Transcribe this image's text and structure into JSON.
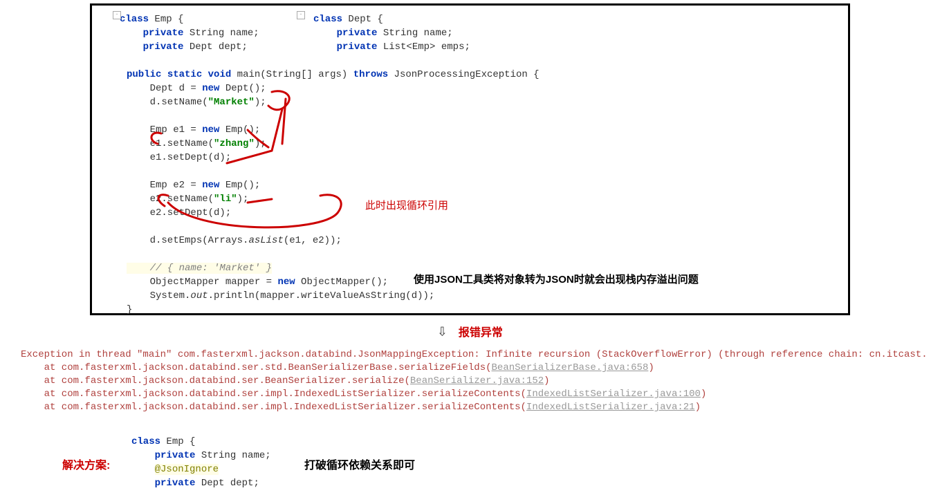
{
  "code": {
    "emp_class": {
      "kw_class": "class",
      "name": "Emp {",
      "kw_private1": "private",
      "type1": "String",
      "field1": "name;",
      "kw_private2": "private",
      "type2": "Dept",
      "field2": "dept;"
    },
    "dept_class": {
      "kw_class": "class",
      "name": "Dept {",
      "kw_private1": "private",
      "type1": "String",
      "field1": "name;",
      "kw_private2": "private",
      "type2": "List<Emp>",
      "field2": "emps;"
    },
    "main": {
      "sig_public": "public",
      "sig_static": "static",
      "sig_void": "void",
      "sig_name": "main(String[] args)",
      "sig_throws": "throws",
      "sig_ex": "JsonProcessingException {",
      "l1a": "    Dept d = ",
      "l1_new": "new",
      "l1b": " Dept();",
      "l2a": "    d.setName(",
      "l2_str": "\"Market\"",
      "l2b": ");",
      "l3a": "    Emp e1 = ",
      "l3_new": "new",
      "l3b": " Emp();",
      "l4a": "    e1.setName(",
      "l4_str": "\"zhang\"",
      "l4b": ");",
      "l5": "    e1.setDept(d);",
      "l6a": "    Emp e2 = ",
      "l6_new": "new",
      "l6b": " Emp();",
      "l7a": "    e2.setName(",
      "l7_str": "\"li\"",
      "l7b": ");",
      "l8": "    e2.setDept(d);",
      "l9a": "    d.setEmps(Arrays.",
      "l9_it": "asList",
      "l9b": "(e1, e2));",
      "cmt": "    // { name: 'Market' }",
      "l10a": "    ObjectMapper mapper = ",
      "l10_new": "new",
      "l10b": " ObjectMapper();",
      "l11a": "    System.",
      "l11_it": "out",
      "l11b": ".println(mapper.writeValueAsString(d));",
      "close": "}"
    }
  },
  "annotations": {
    "cycle_ref": "此时出现循环引用",
    "json_overflow": "使用JSON工具类将对象转为JSON时就会出现栈内存溢出问题",
    "error_label": "报错异常",
    "solution_label": "解决方案:",
    "solution_note": "打破循环依赖关系即可"
  },
  "stacktrace": {
    "l1": "Exception in thread \"main\" com.fasterxml.jackson.databind.JsonMappingException: Infinite recursion (StackOverflowError) (through reference chain: cn.itcast.",
    "l2a": "    at com.fasterxml.jackson.databind.ser.std.BeanSerializerBase.serializeFields(",
    "l2link": "BeanSerializerBase.java:658",
    "l3a": "    at com.fasterxml.jackson.databind.ser.BeanSerializer.serialize(",
    "l3link": "BeanSerializer.java:152",
    "l4a": "    at com.fasterxml.jackson.databind.ser.impl.IndexedListSerializer.serializeContents(",
    "l4link": "IndexedListSerializer.java:100",
    "l5a": "    at com.fasterxml.jackson.databind.ser.impl.IndexedListSerializer.serializeContents(",
    "l5link": "IndexedListSerializer.java:21",
    "close": ")"
  },
  "solution_code": {
    "kw_class": "class",
    "cname": "Emp {",
    "kw_private1": "private",
    "t1": "String",
    "f1": "name;",
    "anno": "@JsonIgnore",
    "kw_private2": "private",
    "t2": "Dept",
    "f2": "dept;"
  },
  "gutter_minus": "-"
}
